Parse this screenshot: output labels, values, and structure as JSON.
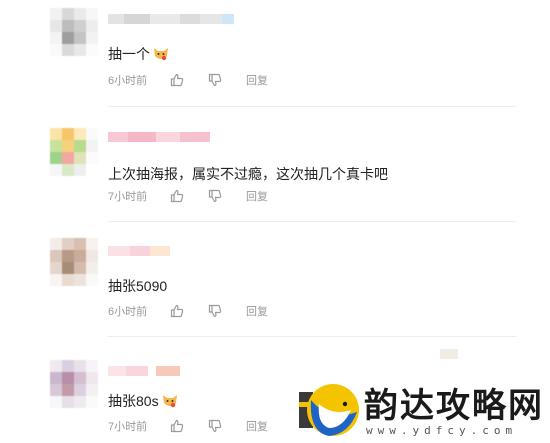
{
  "comments": [
    {
      "text": "抽一个",
      "has_emoji": true,
      "emoji_icon": "cat-face-emoji",
      "time": "6小时前",
      "like_icon": "thumbs-up-icon",
      "dislike_icon": "thumbs-down-icon",
      "reply_label": "回复"
    },
    {
      "text": "上次抽海报，属实不过瘾，这次抽几个真卡吧",
      "has_emoji": false,
      "time": "7小时前",
      "like_icon": "thumbs-up-icon",
      "dislike_icon": "thumbs-down-icon",
      "reply_label": "回复"
    },
    {
      "text": "抽张5090",
      "has_emoji": false,
      "time": "6小时前",
      "like_icon": "thumbs-up-icon",
      "dislike_icon": "thumbs-down-icon",
      "reply_label": "回复"
    },
    {
      "text": "抽张80s",
      "has_emoji": true,
      "emoji_icon": "cat-face-emoji",
      "time": "7小时前",
      "like_icon": "thumbs-up-icon",
      "dislike_icon": "thumbs-down-icon",
      "reply_label": "回复"
    }
  ],
  "watermark": {
    "site_name": "韵达攻略网",
    "url": "www.ydfcy.com",
    "logo_icon": "moon-bird-logo"
  },
  "colors": {
    "text": "#222222",
    "meta": "#999999",
    "divider": "#ececec"
  }
}
